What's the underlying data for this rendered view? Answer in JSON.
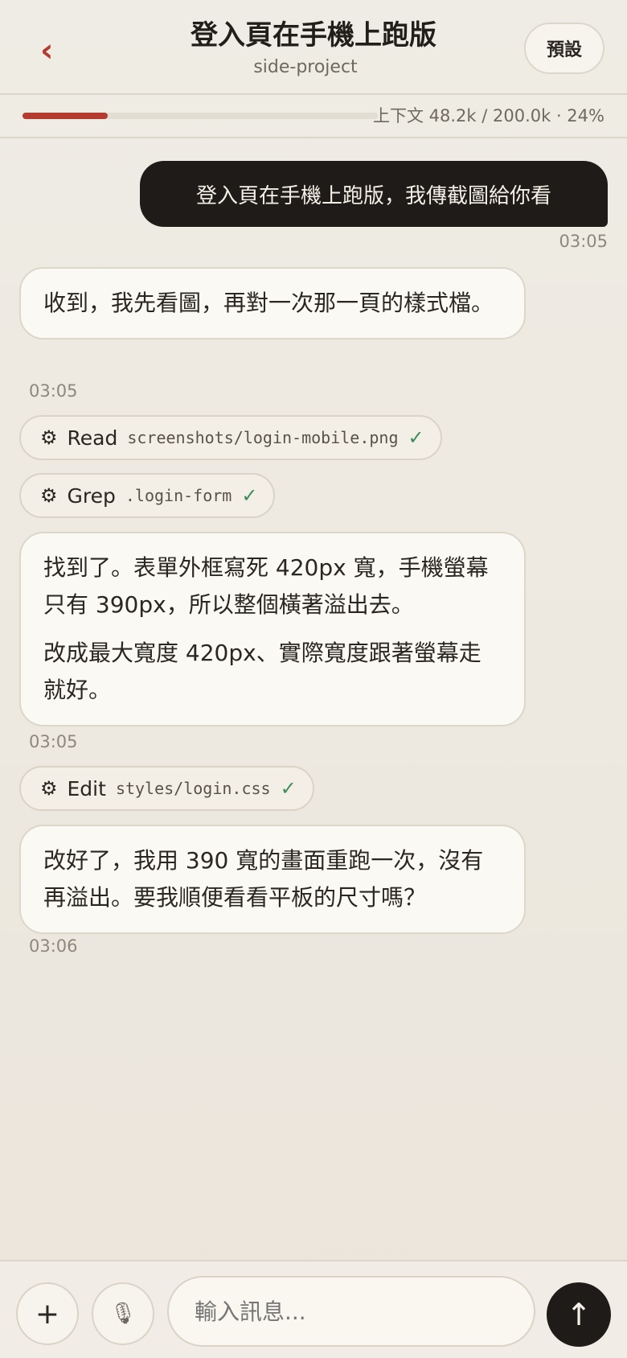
{
  "header": {
    "back_icon": "‹",
    "title": "登入頁在手機上跑版",
    "subtitle": "side-project",
    "preset_label": "預設"
  },
  "context": {
    "label": "上下文 48.2k / 200.0k · 24%",
    "fraction": 0.24
  },
  "messages": {
    "user1": {
      "text": "登入頁在手機上跑版，我傳截圖給你看",
      "time": "03:05"
    },
    "a1": {
      "text": "收到，我先看圖，再對一次那一頁的樣式檔。",
      "time": "03:05"
    },
    "tool1": {
      "name": "Read",
      "arg": "screenshots/login-mobile.png",
      "check": "✓"
    },
    "tool2": {
      "name": "Grep",
      "arg": ".login-form",
      "check": "✓"
    },
    "a2": {
      "p1": "找到了。表單外框寫死 420px 寬，手機螢幕只有 390px，所以整個橫著溢出去。",
      "p2": "改成最大寬度 420px、實際寬度跟著螢幕走就好。",
      "time": "03:05"
    },
    "tool3": {
      "name": "Edit",
      "arg": "styles/login.css",
      "check": "✓"
    },
    "a3": {
      "text": "改好了，我用 390 寬的畫面重跑一次，沒有再溢出。要我順便看看平板的尺寸嗎？",
      "time": "03:06"
    }
  },
  "composer": {
    "plus_icon": "+",
    "mic_icon": "🎙",
    "placeholder": "輸入訊息...",
    "send_icon": "↑"
  },
  "colors": {
    "accent": "#b43b30",
    "dark_bubble": "#1f1b18",
    "success": "#3f8d5a"
  }
}
